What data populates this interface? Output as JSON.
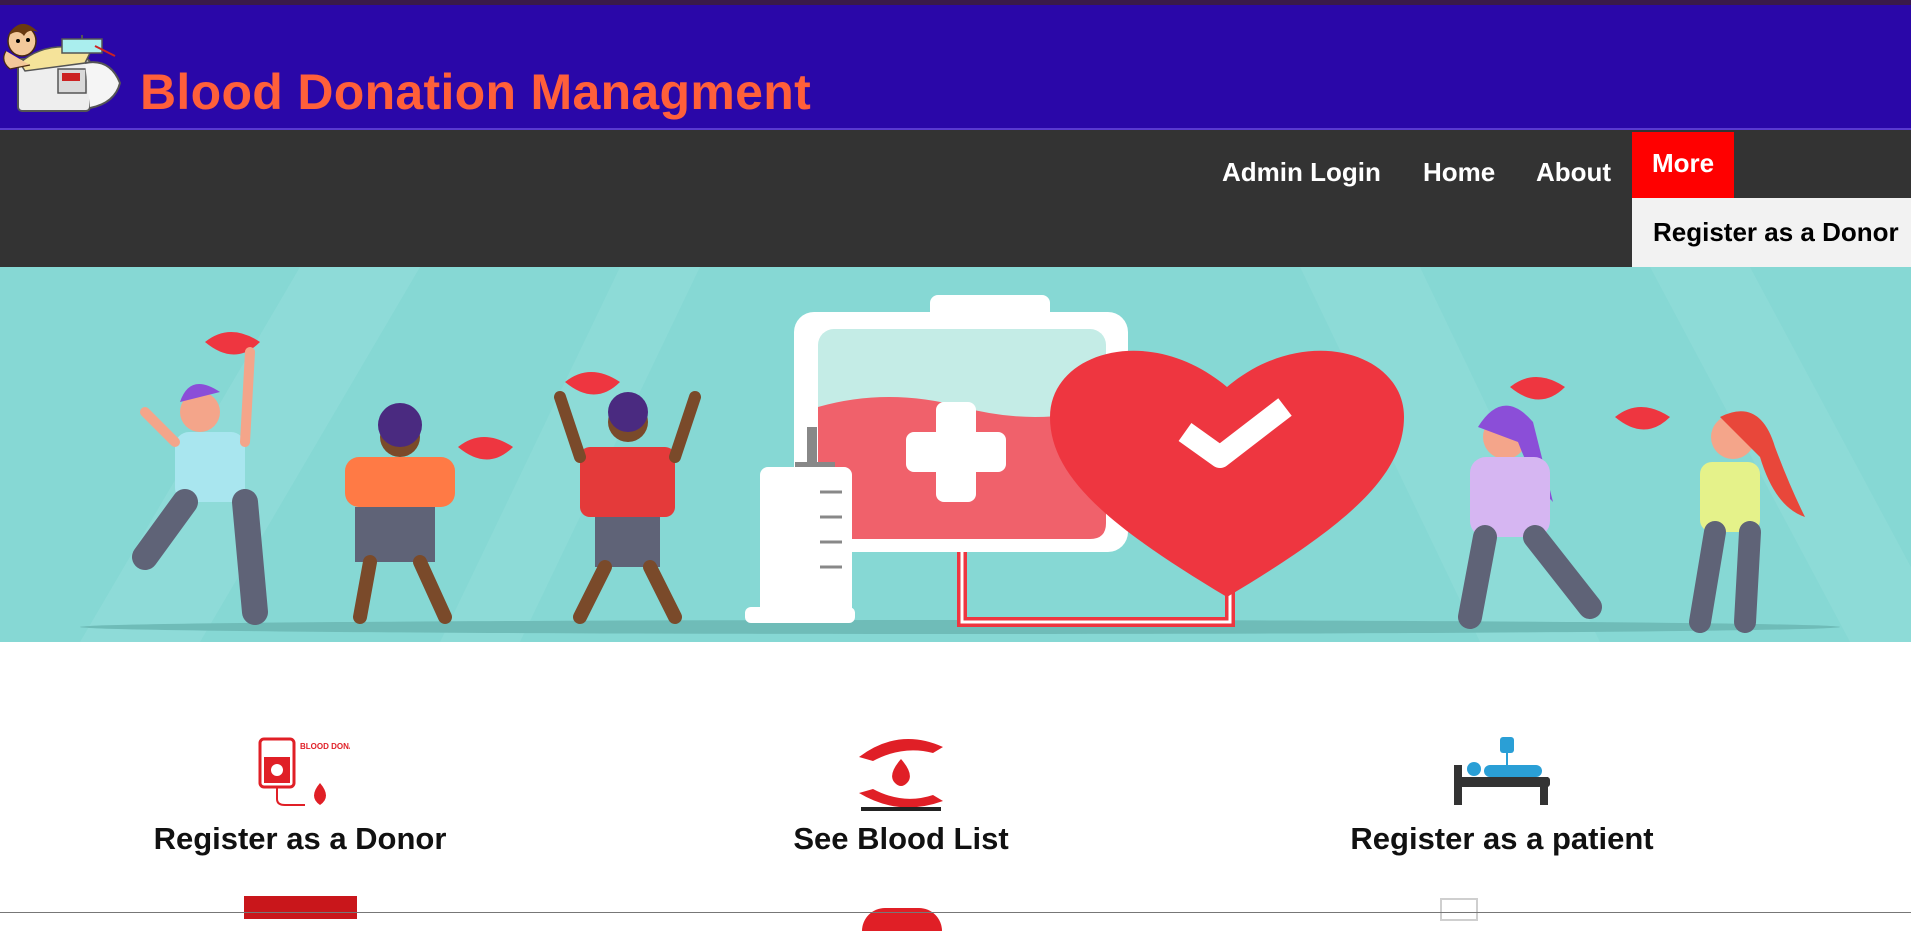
{
  "header": {
    "title": "Blood Donation Managment"
  },
  "nav": {
    "links": [
      "Admin Login",
      "Home",
      "About"
    ],
    "more_label": "More",
    "dropdown_item": "Register as a Donor"
  },
  "cards": [
    {
      "label": "Register as a Donor",
      "icon": "blood-bag-icon",
      "icon_text": "BLOOD DONATION"
    },
    {
      "label": "See Blood List",
      "icon": "caring-hands-drop-icon"
    },
    {
      "label": "Register as a patient",
      "icon": "patient-bed-icon"
    }
  ],
  "colors": {
    "header_bg": "#2a07a8",
    "title": "#ff5f3a",
    "nav_bg": "#333333",
    "more_bg": "#ff0000",
    "hero_bg": "#86d8d4",
    "blood_red": "#ee3640"
  }
}
